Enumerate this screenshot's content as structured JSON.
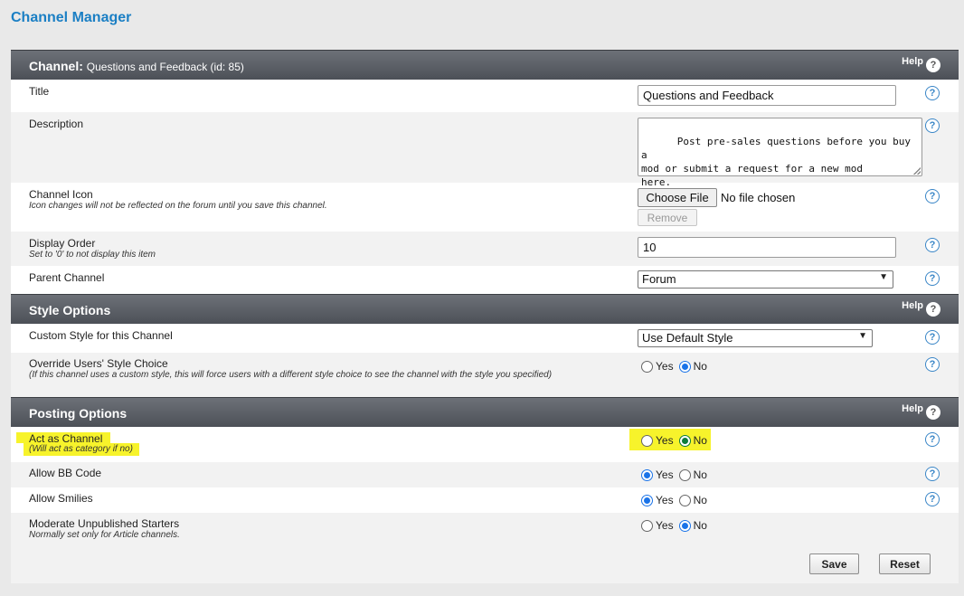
{
  "page": {
    "title": "Channel Manager"
  },
  "help_label": "Help",
  "help_glyph": "?",
  "channel_section": {
    "title": "Channel:",
    "subtitle": "Questions and Feedback (id: 85)",
    "title_field": {
      "label": "Title",
      "value": "Questions and Feedback"
    },
    "description": {
      "label": "Description",
      "value": "Post pre-sales questions before you buy a\nmod or submit a request for a new mod\nhere."
    },
    "channel_icon": {
      "label": "Channel Icon",
      "note": "Icon changes will not be reflected on the forum until you save this channel.",
      "choose_button": "Choose File",
      "file_status": "No file chosen",
      "remove_button": "Remove"
    },
    "display_order": {
      "label": "Display Order",
      "note": "Set to '0' to not display this item",
      "value": "10"
    },
    "parent_channel": {
      "label": "Parent Channel",
      "selected": "Forum"
    }
  },
  "style_section": {
    "title": "Style Options",
    "custom_style": {
      "label": "Custom Style for this Channel",
      "selected": "Use Default Style"
    },
    "override": {
      "label": "Override Users' Style Choice",
      "note": "(If this channel uses a custom style, this will force users with a different style choice to see the channel with the style you specified)",
      "yes": "Yes",
      "no": "No",
      "selected": "No"
    }
  },
  "posting_section": {
    "title": "Posting Options",
    "act_as_channel": {
      "label": "Act as Channel",
      "note": "(Will act as category if no)",
      "yes": "Yes",
      "no": "No",
      "selected": "No"
    },
    "allow_bbcode": {
      "label": "Allow BB Code",
      "yes": "Yes",
      "no": "No",
      "selected": "Yes"
    },
    "allow_smilies": {
      "label": "Allow Smilies",
      "yes": "Yes",
      "no": "No",
      "selected": "Yes"
    },
    "moderate": {
      "label": "Moderate Unpublished Starters",
      "note": "Normally set only for Article channels.",
      "yes": "Yes",
      "no": "No",
      "selected": "No"
    }
  },
  "actions": {
    "save": "Save",
    "reset": "Reset"
  },
  "colors": {
    "title_blue": "#1b7fc4",
    "header_gray": "#5a5e65",
    "highlight": "#f7f32b"
  }
}
